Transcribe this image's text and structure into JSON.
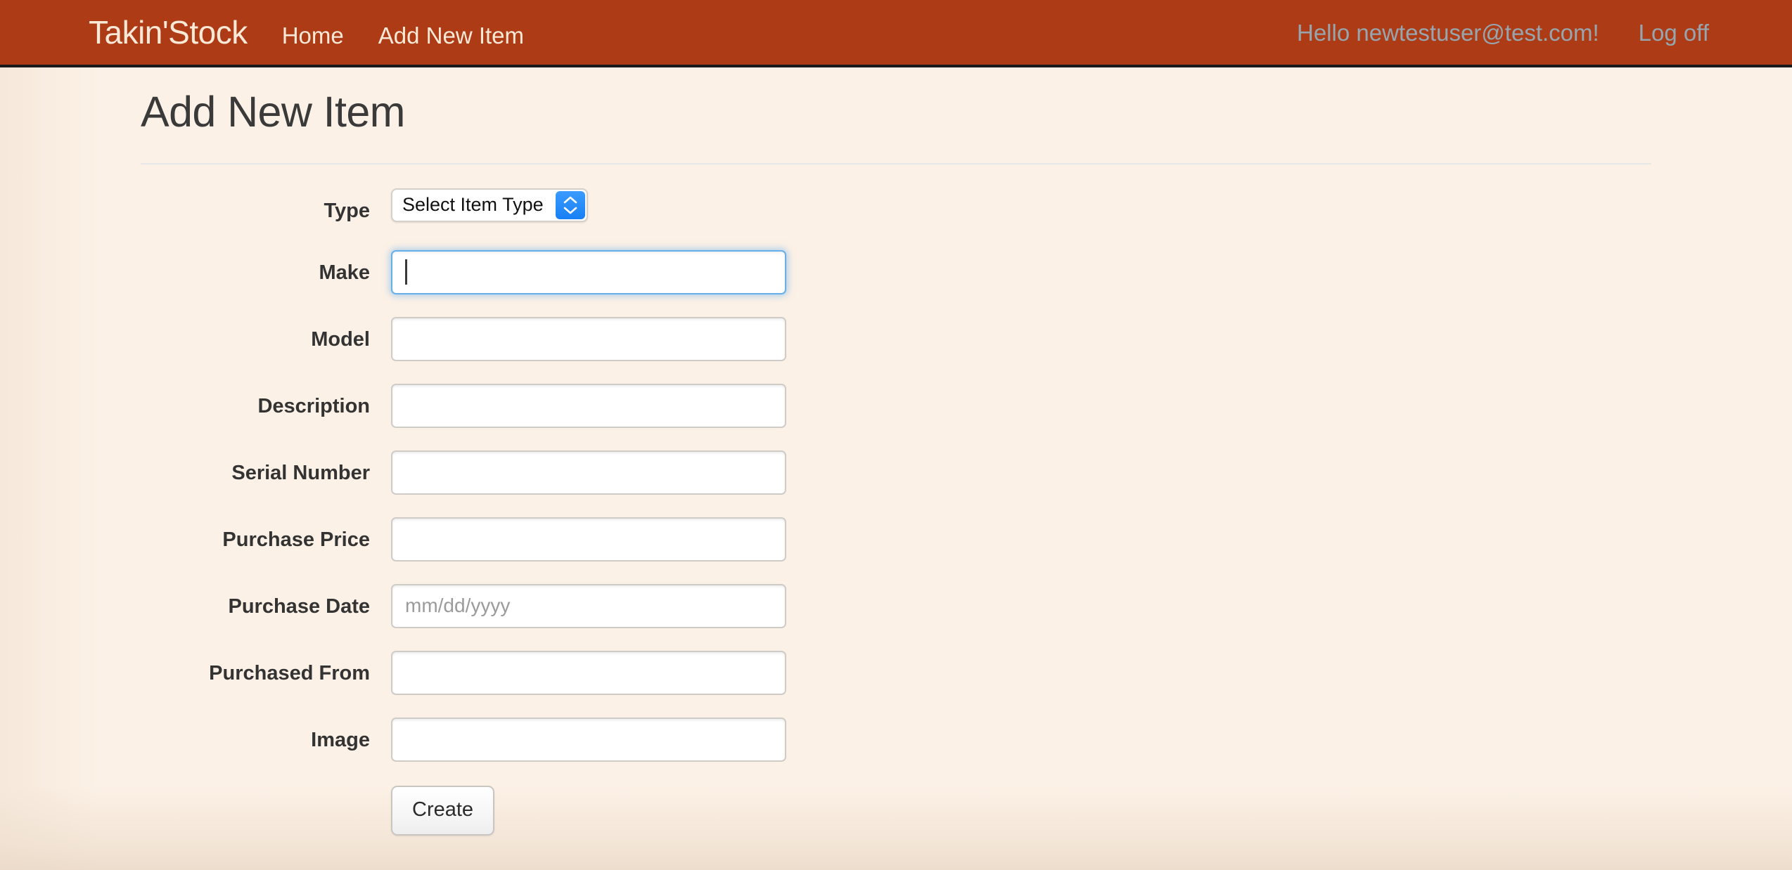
{
  "navbar": {
    "brand": "Takin'Stock",
    "links": [
      {
        "label": "Home"
      },
      {
        "label": "Add New Item"
      }
    ],
    "greeting": "Hello newtestuser@test.com!",
    "logoff_label": "Log off",
    "background_color": "#ad3b16",
    "brand_color": "#fbe9d7",
    "muted_link_color": "#97a6ae"
  },
  "page": {
    "title": "Add New Item",
    "background_color": "#fcf1e6",
    "title_color": "#3a3a3a"
  },
  "form": {
    "fields": [
      {
        "label": "Type",
        "control": "select",
        "value": "Select Item Type",
        "placeholder": "",
        "focused": false
      },
      {
        "label": "Make",
        "control": "text",
        "value": "",
        "placeholder": "",
        "focused": true
      },
      {
        "label": "Model",
        "control": "text",
        "value": "",
        "placeholder": "",
        "focused": false
      },
      {
        "label": "Description",
        "control": "text",
        "value": "",
        "placeholder": "",
        "focused": false
      },
      {
        "label": "Serial Number",
        "control": "text",
        "value": "",
        "placeholder": "",
        "focused": false
      },
      {
        "label": "Purchase Price",
        "control": "text",
        "value": "",
        "placeholder": "",
        "focused": false
      },
      {
        "label": "Purchase Date",
        "control": "text",
        "value": "",
        "placeholder": "mm/dd/yyyy",
        "focused": false
      },
      {
        "label": "Purchased From",
        "control": "text",
        "value": "",
        "placeholder": "",
        "focused": false
      },
      {
        "label": "Image",
        "control": "text",
        "value": "",
        "placeholder": "",
        "focused": false
      }
    ],
    "submit_label": "Create",
    "focus_ring_color": "#66afe9",
    "stepper_color": "#1780f5"
  }
}
